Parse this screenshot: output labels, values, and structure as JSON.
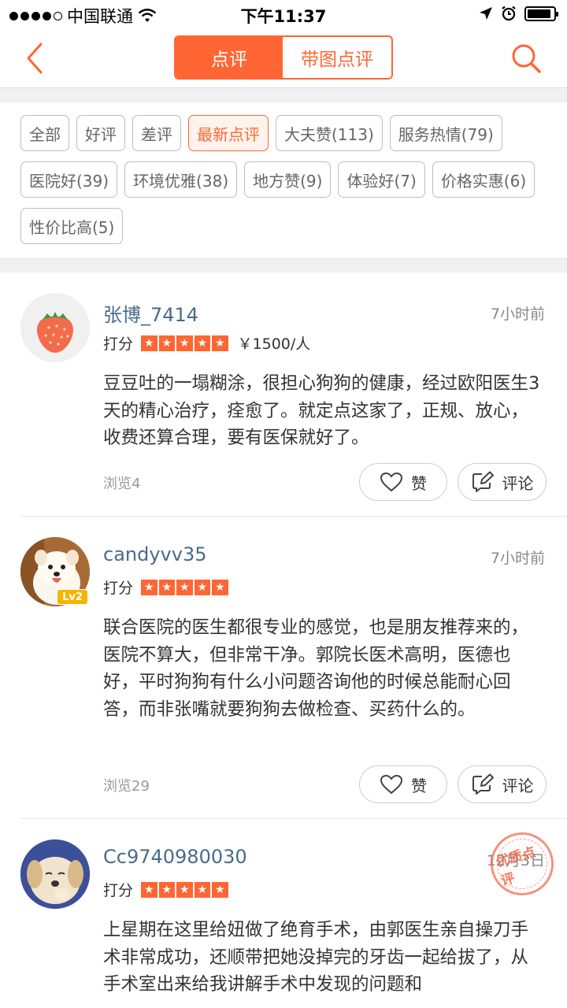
{
  "status_bar": {
    "carrier": "中国联通",
    "time": "下午11:37",
    "battery_level": 0.9
  },
  "nav": {
    "tabs": [
      {
        "label": "点评",
        "active": true
      },
      {
        "label": "带图点评",
        "active": false
      }
    ],
    "back_icon": "back-arrow-icon",
    "search_icon": "search-icon"
  },
  "filters": [
    {
      "label": "全部",
      "active": false
    },
    {
      "label": "好评",
      "active": false
    },
    {
      "label": "差评",
      "active": false
    },
    {
      "label": "最新点评",
      "active": true
    },
    {
      "label": "大夫赞(113)",
      "active": false
    },
    {
      "label": "服务热情(79)",
      "active": false
    },
    {
      "label": "医院好(39)",
      "active": false
    },
    {
      "label": "环境优雅(38)",
      "active": false
    },
    {
      "label": "地方赞(9)",
      "active": false
    },
    {
      "label": "体验好(7)",
      "active": false
    },
    {
      "label": "价格实惠(6)",
      "active": false
    },
    {
      "label": "性价比高(5)",
      "active": false
    }
  ],
  "reviews": [
    {
      "user": "张博_7414",
      "time": "7小时前",
      "score_label": "打分",
      "stars": 5,
      "price": "￥1500/人",
      "content": "豆豆吐的一塌糊涂，很担心狗狗的健康，经过欧阳医生3天的精心治疗，痊愈了。就定点这家了，正规、放心，收费还算合理，要有医保就好了。",
      "views": "浏览4",
      "like_label": "赞",
      "comment_label": "评论"
    },
    {
      "user": "candyvv35",
      "time": "7小时前",
      "score_label": "打分",
      "stars": 5,
      "level": "Lv2",
      "content": "联合医院的医生都很专业的感觉，也是朋友推荐来的，医院不算大，但非常干净。郭院长医术高明，医德也好，平时狗狗有什么小问题咨询他的时候总能耐心回答，而非张嘴就要狗狗去做检查、买药什么的。",
      "views": "浏览29",
      "like_label": "赞",
      "comment_label": "评论"
    },
    {
      "user": "Cc9740980030",
      "time": "12月3日",
      "score_label": "打分",
      "stars": 5,
      "stamp": "优质点评",
      "content": "上星期在这里给妞做了绝育手术，由郭医生亲自操刀手术非常成功，还顺带把她没掉完的牙齿一起给拔了，从手术室出来给我讲解手术中发现的问题和"
    }
  ],
  "colors": {
    "accent": "#ff6633",
    "username": "#4a6a8c"
  }
}
